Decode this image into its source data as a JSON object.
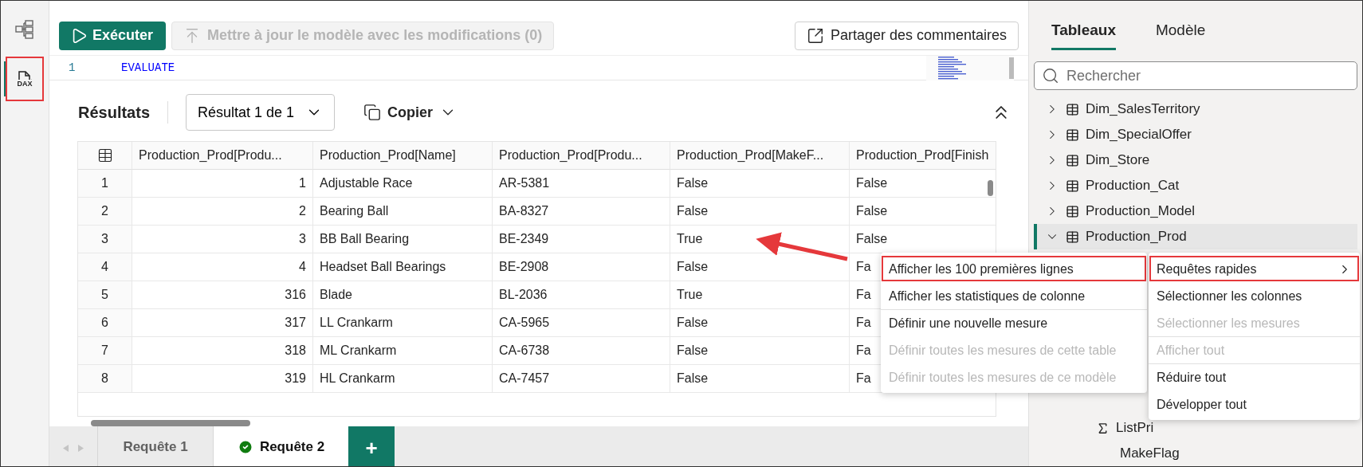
{
  "rail": {
    "items": [
      {
        "kind": "diagram",
        "selected": false,
        "annotated": false
      },
      {
        "kind": "dax",
        "label": "DAX",
        "selected": true,
        "annotated": true
      }
    ]
  },
  "toolbar": {
    "run_button": "Exécuter",
    "update_button": {
      "label": "Mettre à jour le modèle avec les modifications (0)",
      "disabled": true
    },
    "share_button": "Partager des commentaires"
  },
  "editor": {
    "lines": [
      {
        "number": "1",
        "code": "EVALUATE"
      }
    ]
  },
  "results": {
    "title": "Résultats",
    "result_select": "Résultat 1 de 1",
    "copy_button": "Copier"
  },
  "table": {
    "columns": [
      "Production_Prod[Produ...",
      "Production_Prod[Name]",
      "Production_Prod[Produ...",
      "Production_Prod[MakeF...",
      "Production_Prod[Finish"
    ],
    "rows": [
      {
        "index": "1",
        "cells": [
          "1",
          "Adjustable Race",
          "AR-5381",
          "False",
          "False"
        ]
      },
      {
        "index": "2",
        "cells": [
          "2",
          "Bearing Ball",
          "BA-8327",
          "False",
          "False"
        ]
      },
      {
        "index": "3",
        "cells": [
          "3",
          "BB Ball Bearing",
          "BE-2349",
          "True",
          "False"
        ]
      },
      {
        "index": "4",
        "cells": [
          "4",
          "Headset Ball Bearings",
          "BE-2908",
          "False",
          "Fa"
        ]
      },
      {
        "index": "5",
        "cells": [
          "316",
          "Blade",
          "BL-2036",
          "True",
          "Fa"
        ]
      },
      {
        "index": "6",
        "cells": [
          "317",
          "LL Crankarm",
          "CA-5965",
          "False",
          "Fa"
        ]
      },
      {
        "index": "7",
        "cells": [
          "318",
          "ML Crankarm",
          "CA-6738",
          "False",
          "Fa"
        ]
      },
      {
        "index": "8",
        "cells": [
          "319",
          "HL Crankarm",
          "CA-7457",
          "False",
          "Fa"
        ]
      }
    ]
  },
  "query_tabs": [
    {
      "label": "Requête 1",
      "selected": false,
      "succeeded": false
    },
    {
      "label": "Requête 2",
      "selected": true,
      "succeeded": true
    }
  ],
  "add_tab_button": "+",
  "side_panel": {
    "tabs": [
      {
        "label": "Tableaux",
        "selected": true
      },
      {
        "label": "Modèle",
        "selected": false
      }
    ],
    "search": {
      "placeholder": "Rechercher"
    },
    "tree": [
      {
        "label": "Dim_SalesTerritory",
        "kind": "table",
        "expanded": false,
        "selected": false
      },
      {
        "label": "Dim_SpecialOffer",
        "kind": "table",
        "expanded": false,
        "selected": false
      },
      {
        "label": "Dim_Store",
        "kind": "table",
        "expanded": false,
        "selected": false
      },
      {
        "label": "Production_Cat",
        "kind": "table",
        "expanded": false,
        "selected": false
      },
      {
        "label": "Production_Model",
        "kind": "table",
        "expanded": false,
        "selected": false
      },
      {
        "label": "Production_Prod",
        "kind": "table",
        "expanded": true,
        "selected": true,
        "children": [
          {
            "label": "ListPri",
            "kind": "measure"
          },
          {
            "label": "MakeFlag",
            "kind": "column"
          }
        ]
      }
    ]
  },
  "context_menu": {
    "items": [
      {
        "label": "Afficher les 100 premières lignes",
        "disabled": false,
        "annotated": true,
        "divider_before": false
      },
      {
        "label": "Afficher les statistiques de colonne",
        "disabled": false,
        "annotated": false,
        "divider_before": false
      },
      {
        "label": "Définir une nouvelle mesure",
        "disabled": false,
        "annotated": false,
        "divider_before": true
      },
      {
        "label": "Définir toutes les mesures de cette table",
        "disabled": true,
        "annotated": false,
        "divider_before": false
      },
      {
        "label": "Définir toutes les mesures de ce modèle",
        "disabled": true,
        "annotated": false,
        "divider_before": false
      }
    ]
  },
  "submenu": {
    "items": [
      {
        "label": "Requêtes rapides",
        "disabled": false,
        "annotated": true,
        "divider_before": false,
        "has_submenu": true
      },
      {
        "label": "Sélectionner les colonnes",
        "disabled": false,
        "annotated": false,
        "divider_before": false,
        "has_submenu": false
      },
      {
        "label": "Sélectionner les mesures",
        "disabled": true,
        "annotated": false,
        "divider_before": false,
        "has_submenu": false
      },
      {
        "label": "Afficher tout",
        "disabled": true,
        "annotated": false,
        "divider_before": true,
        "has_submenu": false
      },
      {
        "label": "Réduire tout",
        "disabled": false,
        "annotated": false,
        "divider_before": true,
        "has_submenu": false
      },
      {
        "label": "Développer tout",
        "disabled": false,
        "annotated": false,
        "divider_before": false,
        "has_submenu": false
      }
    ]
  }
}
